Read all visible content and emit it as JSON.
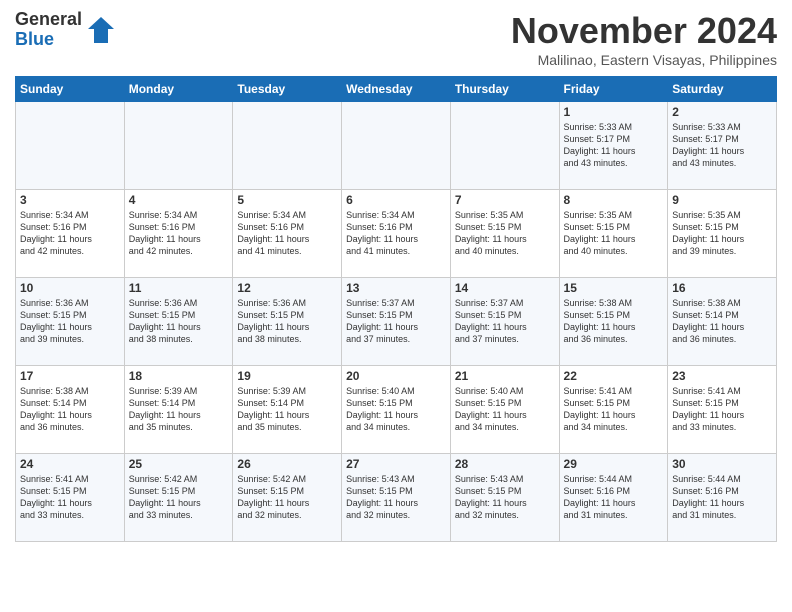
{
  "logo": {
    "general": "General",
    "blue": "Blue"
  },
  "title": "November 2024",
  "location": "Malilinao, Eastern Visayas, Philippines",
  "weekdays": [
    "Sunday",
    "Monday",
    "Tuesday",
    "Wednesday",
    "Thursday",
    "Friday",
    "Saturday"
  ],
  "weeks": [
    [
      {
        "day": "",
        "info": ""
      },
      {
        "day": "",
        "info": ""
      },
      {
        "day": "",
        "info": ""
      },
      {
        "day": "",
        "info": ""
      },
      {
        "day": "",
        "info": ""
      },
      {
        "day": "1",
        "info": "Sunrise: 5:33 AM\nSunset: 5:17 PM\nDaylight: 11 hours\nand 43 minutes."
      },
      {
        "day": "2",
        "info": "Sunrise: 5:33 AM\nSunset: 5:17 PM\nDaylight: 11 hours\nand 43 minutes."
      }
    ],
    [
      {
        "day": "3",
        "info": "Sunrise: 5:34 AM\nSunset: 5:16 PM\nDaylight: 11 hours\nand 42 minutes."
      },
      {
        "day": "4",
        "info": "Sunrise: 5:34 AM\nSunset: 5:16 PM\nDaylight: 11 hours\nand 42 minutes."
      },
      {
        "day": "5",
        "info": "Sunrise: 5:34 AM\nSunset: 5:16 PM\nDaylight: 11 hours\nand 41 minutes."
      },
      {
        "day": "6",
        "info": "Sunrise: 5:34 AM\nSunset: 5:16 PM\nDaylight: 11 hours\nand 41 minutes."
      },
      {
        "day": "7",
        "info": "Sunrise: 5:35 AM\nSunset: 5:15 PM\nDaylight: 11 hours\nand 40 minutes."
      },
      {
        "day": "8",
        "info": "Sunrise: 5:35 AM\nSunset: 5:15 PM\nDaylight: 11 hours\nand 40 minutes."
      },
      {
        "day": "9",
        "info": "Sunrise: 5:35 AM\nSunset: 5:15 PM\nDaylight: 11 hours\nand 39 minutes."
      }
    ],
    [
      {
        "day": "10",
        "info": "Sunrise: 5:36 AM\nSunset: 5:15 PM\nDaylight: 11 hours\nand 39 minutes."
      },
      {
        "day": "11",
        "info": "Sunrise: 5:36 AM\nSunset: 5:15 PM\nDaylight: 11 hours\nand 38 minutes."
      },
      {
        "day": "12",
        "info": "Sunrise: 5:36 AM\nSunset: 5:15 PM\nDaylight: 11 hours\nand 38 minutes."
      },
      {
        "day": "13",
        "info": "Sunrise: 5:37 AM\nSunset: 5:15 PM\nDaylight: 11 hours\nand 37 minutes."
      },
      {
        "day": "14",
        "info": "Sunrise: 5:37 AM\nSunset: 5:15 PM\nDaylight: 11 hours\nand 37 minutes."
      },
      {
        "day": "15",
        "info": "Sunrise: 5:38 AM\nSunset: 5:15 PM\nDaylight: 11 hours\nand 36 minutes."
      },
      {
        "day": "16",
        "info": "Sunrise: 5:38 AM\nSunset: 5:14 PM\nDaylight: 11 hours\nand 36 minutes."
      }
    ],
    [
      {
        "day": "17",
        "info": "Sunrise: 5:38 AM\nSunset: 5:14 PM\nDaylight: 11 hours\nand 36 minutes."
      },
      {
        "day": "18",
        "info": "Sunrise: 5:39 AM\nSunset: 5:14 PM\nDaylight: 11 hours\nand 35 minutes."
      },
      {
        "day": "19",
        "info": "Sunrise: 5:39 AM\nSunset: 5:14 PM\nDaylight: 11 hours\nand 35 minutes."
      },
      {
        "day": "20",
        "info": "Sunrise: 5:40 AM\nSunset: 5:15 PM\nDaylight: 11 hours\nand 34 minutes."
      },
      {
        "day": "21",
        "info": "Sunrise: 5:40 AM\nSunset: 5:15 PM\nDaylight: 11 hours\nand 34 minutes."
      },
      {
        "day": "22",
        "info": "Sunrise: 5:41 AM\nSunset: 5:15 PM\nDaylight: 11 hours\nand 34 minutes."
      },
      {
        "day": "23",
        "info": "Sunrise: 5:41 AM\nSunset: 5:15 PM\nDaylight: 11 hours\nand 33 minutes."
      }
    ],
    [
      {
        "day": "24",
        "info": "Sunrise: 5:41 AM\nSunset: 5:15 PM\nDaylight: 11 hours\nand 33 minutes."
      },
      {
        "day": "25",
        "info": "Sunrise: 5:42 AM\nSunset: 5:15 PM\nDaylight: 11 hours\nand 33 minutes."
      },
      {
        "day": "26",
        "info": "Sunrise: 5:42 AM\nSunset: 5:15 PM\nDaylight: 11 hours\nand 32 minutes."
      },
      {
        "day": "27",
        "info": "Sunrise: 5:43 AM\nSunset: 5:15 PM\nDaylight: 11 hours\nand 32 minutes."
      },
      {
        "day": "28",
        "info": "Sunrise: 5:43 AM\nSunset: 5:15 PM\nDaylight: 11 hours\nand 32 minutes."
      },
      {
        "day": "29",
        "info": "Sunrise: 5:44 AM\nSunset: 5:16 PM\nDaylight: 11 hours\nand 31 minutes."
      },
      {
        "day": "30",
        "info": "Sunrise: 5:44 AM\nSunset: 5:16 PM\nDaylight: 11 hours\nand 31 minutes."
      }
    ]
  ]
}
